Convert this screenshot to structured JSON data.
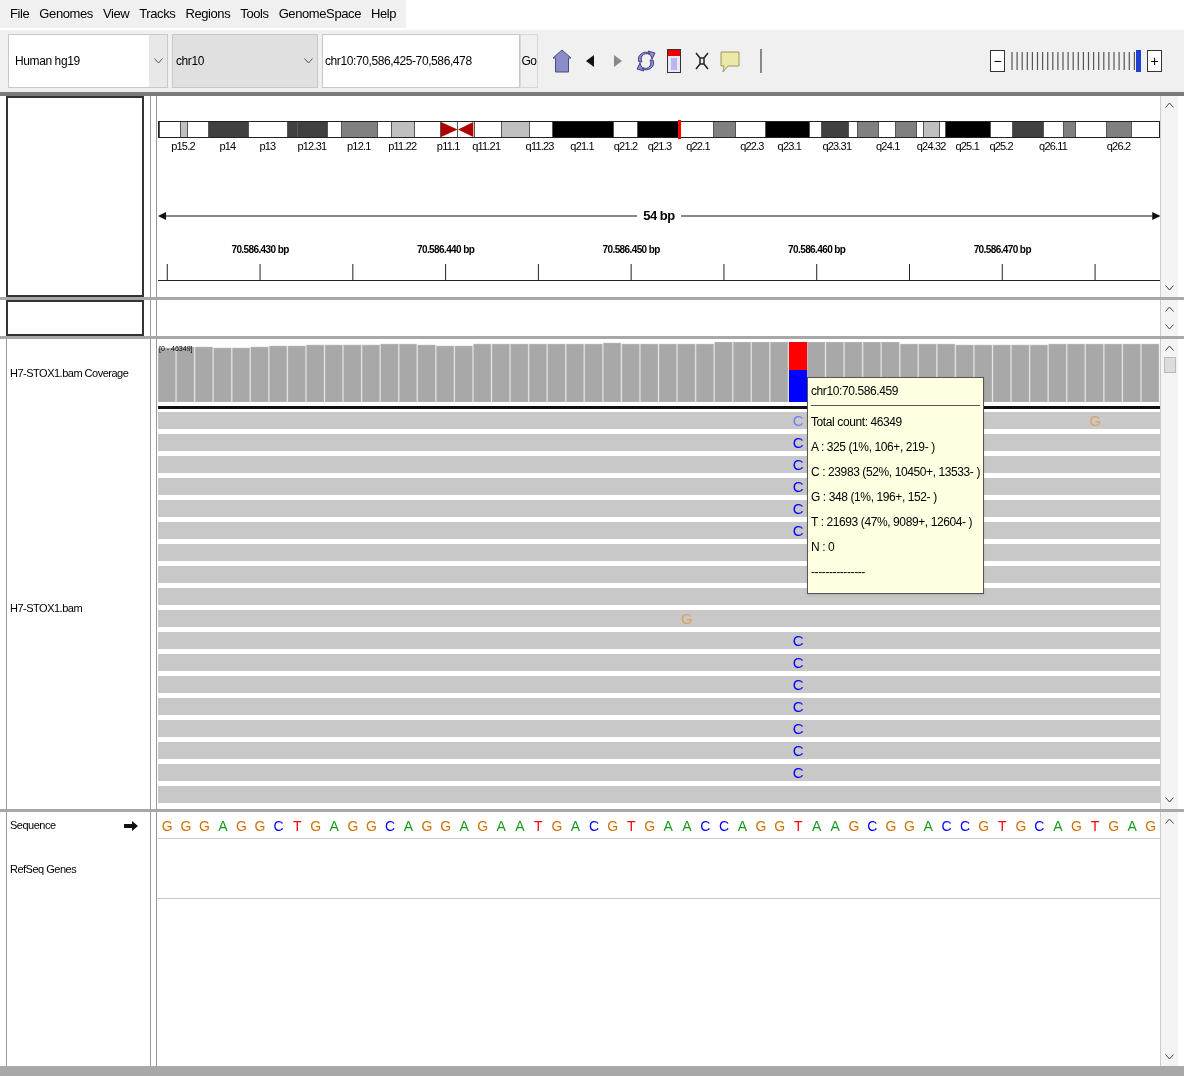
{
  "menu": [
    "File",
    "Genomes",
    "View",
    "Tracks",
    "Regions",
    "Tools",
    "GenomeSpace",
    "Help"
  ],
  "toolbar": {
    "genome": "Human hg19",
    "chromosome": "chr10",
    "locus": "chr10:70,586,425-70,586,478",
    "go": "Go",
    "zoom": {
      "minus": "−",
      "plus": "+",
      "level": 1
    }
  },
  "ideogram": {
    "bands": [
      {
        "kind": "gneg"
      },
      {
        "kind": "gpos25",
        "label": "p15.2"
      },
      {
        "kind": "gneg"
      },
      {
        "kind": "gpos75",
        "label": "p14"
      },
      {
        "kind": "gneg",
        "label": "p13"
      },
      {
        "kind": "gpos75"
      },
      {
        "kind": "gpos75",
        "label": "p12.31"
      },
      {
        "kind": "gneg"
      },
      {
        "kind": "gpos50",
        "label": "p12.1"
      },
      {
        "kind": "gneg"
      },
      {
        "kind": "gpos25",
        "label": "p11.22"
      },
      {
        "kind": "gneg"
      },
      {
        "kind": "acen_p",
        "label": "p11.1"
      },
      {
        "kind": "acen_q"
      },
      {
        "kind": "gneg",
        "label": "q11.21"
      },
      {
        "kind": "gpos25"
      },
      {
        "kind": "gneg",
        "label": "q11.23"
      },
      {
        "kind": "gpos100",
        "label": "q21.1"
      },
      {
        "kind": "gneg",
        "label": "q21.2"
      },
      {
        "kind": "gpos100",
        "label": "q21.3"
      },
      {
        "kind": "gneg",
        "label": "q22.1",
        "marker": true
      },
      {
        "kind": "gpos50"
      },
      {
        "kind": "gneg",
        "label": "q22.3"
      },
      {
        "kind": "gpos100",
        "label": "q23.1"
      },
      {
        "kind": "gneg"
      },
      {
        "kind": "gpos75",
        "label": "q23.31"
      },
      {
        "kind": "gneg"
      },
      {
        "kind": "gpos50"
      },
      {
        "kind": "gneg",
        "label": "q24.1"
      },
      {
        "kind": "gpos50"
      },
      {
        "kind": "gneg"
      },
      {
        "kind": "gpos25",
        "label": "q24.32"
      },
      {
        "kind": "gneg"
      },
      {
        "kind": "gpos100",
        "label": "q25.1"
      },
      {
        "kind": "gneg",
        "label": "q25.2"
      },
      {
        "kind": "gpos75"
      },
      {
        "kind": "gneg",
        "label": "q26.11"
      },
      {
        "kind": "gpos50"
      },
      {
        "kind": "gneg"
      },
      {
        "kind": "gpos50",
        "label": "q26.2"
      },
      {
        "kind": "gneg"
      }
    ]
  },
  "ruler": {
    "span": "54 bp",
    "ticks": [
      "70.586.430 bp",
      "70.586.440 bp",
      "70.586.450 bp",
      "70.586.460 bp",
      "70.586.470 bp"
    ]
  },
  "coverage": {
    "name": "H7-STOX1.bam Coverage",
    "range": "[0 - 46349]"
  },
  "alignment": {
    "name": "H7-STOX1.bam",
    "rows": [
      {
        "cells": [
          null,
          null,
          null,
          null,
          null,
          null,
          null,
          null,
          null,
          null,
          null,
          null,
          null,
          null,
          null,
          null,
          null,
          null,
          null,
          null,
          null,
          null,
          null,
          null,
          null,
          null,
          null,
          null,
          null,
          null,
          null,
          null,
          null,
          null,
          {
            "base": "C",
            "faded": true
          },
          null,
          null,
          null,
          null,
          null,
          null,
          null,
          null,
          null,
          null,
          null,
          null,
          null,
          null,
          null,
          {
            "base": "G",
            "faded": true
          },
          null,
          null,
          null
        ]
      },
      {
        "cells": [
          null,
          null,
          null,
          null,
          null,
          null,
          null,
          null,
          null,
          null,
          null,
          null,
          null,
          null,
          null,
          null,
          null,
          null,
          null,
          null,
          null,
          null,
          null,
          null,
          null,
          null,
          null,
          null,
          null,
          null,
          null,
          null,
          null,
          null,
          {
            "base": "C",
            "faded": false
          },
          null,
          null,
          null,
          null,
          null,
          null,
          null,
          null,
          null,
          null,
          null,
          null,
          null,
          null,
          null,
          null,
          null,
          null,
          null
        ]
      },
      {
        "cells": [
          null,
          null,
          null,
          null,
          null,
          null,
          null,
          null,
          null,
          null,
          null,
          null,
          null,
          null,
          null,
          null,
          null,
          null,
          null,
          null,
          null,
          null,
          null,
          null,
          null,
          null,
          null,
          null,
          null,
          null,
          null,
          null,
          null,
          null,
          {
            "base": "C",
            "faded": false
          },
          null,
          null,
          null,
          null,
          null,
          null,
          null,
          null,
          null,
          null,
          null,
          null,
          null,
          null,
          null,
          null,
          null,
          null,
          null
        ]
      },
      {
        "cells": [
          null,
          null,
          null,
          null,
          null,
          null,
          null,
          null,
          null,
          null,
          null,
          null,
          null,
          null,
          null,
          null,
          null,
          null,
          null,
          null,
          null,
          null,
          null,
          null,
          null,
          null,
          null,
          null,
          null,
          null,
          null,
          null,
          null,
          null,
          {
            "base": "C",
            "faded": false
          },
          null,
          null,
          null,
          null,
          null,
          null,
          null,
          null,
          null,
          null,
          null,
          null,
          null,
          null,
          null,
          null,
          null,
          null,
          null
        ]
      },
      {
        "cells": [
          null,
          null,
          null,
          null,
          null,
          null,
          null,
          null,
          null,
          null,
          null,
          null,
          null,
          null,
          null,
          null,
          null,
          null,
          null,
          null,
          null,
          null,
          null,
          null,
          null,
          null,
          null,
          null,
          null,
          null,
          null,
          null,
          null,
          null,
          {
            "base": "C",
            "faded": false
          },
          null,
          null,
          null,
          null,
          null,
          null,
          null,
          null,
          null,
          null,
          null,
          null,
          null,
          null,
          null,
          null,
          null,
          null,
          null
        ]
      },
      {
        "cells": [
          null,
          null,
          null,
          null,
          null,
          null,
          null,
          null,
          null,
          null,
          null,
          null,
          null,
          null,
          null,
          null,
          null,
          null,
          null,
          null,
          null,
          null,
          null,
          null,
          null,
          null,
          null,
          null,
          null,
          null,
          null,
          null,
          null,
          null,
          {
            "base": "C",
            "faded": false
          },
          null,
          null,
          null,
          null,
          null,
          null,
          null,
          null,
          null,
          null,
          null,
          null,
          null,
          null,
          null,
          null,
          null,
          null,
          null
        ]
      },
      {
        "cells": [
          null,
          null,
          null,
          null,
          null,
          null,
          null,
          null,
          null,
          null,
          null,
          null,
          null,
          null,
          null,
          null,
          null,
          null,
          null,
          null,
          null,
          null,
          null,
          null,
          null,
          null,
          null,
          null,
          null,
          null,
          null,
          null,
          null,
          null,
          null,
          null,
          null,
          null,
          null,
          null,
          null,
          null,
          null,
          null,
          null,
          null,
          null,
          null,
          null,
          null,
          null,
          null,
          null,
          null
        ]
      },
      {
        "cells": [
          null,
          null,
          null,
          null,
          null,
          null,
          null,
          null,
          null,
          null,
          null,
          null,
          null,
          null,
          null,
          null,
          null,
          null,
          null,
          null,
          null,
          null,
          null,
          null,
          null,
          null,
          null,
          null,
          null,
          null,
          null,
          null,
          null,
          null,
          null,
          null,
          null,
          null,
          null,
          null,
          null,
          null,
          null,
          null,
          null,
          null,
          null,
          null,
          null,
          null,
          null,
          null,
          null,
          null
        ]
      },
      {
        "cells": [
          null,
          null,
          null,
          null,
          null,
          null,
          null,
          null,
          null,
          null,
          null,
          null,
          null,
          null,
          null,
          null,
          null,
          null,
          null,
          null,
          null,
          null,
          null,
          null,
          null,
          null,
          null,
          null,
          null,
          null,
          null,
          null,
          null,
          null,
          null,
          null,
          null,
          null,
          null,
          null,
          null,
          null,
          null,
          null,
          null,
          null,
          null,
          null,
          null,
          null,
          null,
          null,
          null,
          null
        ]
      },
      {
        "cells": [
          null,
          null,
          null,
          null,
          null,
          null,
          null,
          null,
          null,
          null,
          null,
          null,
          null,
          null,
          null,
          null,
          null,
          null,
          null,
          null,
          null,
          null,
          null,
          null,
          null,
          null,
          null,
          null,
          {
            "base": "G",
            "faded": true
          },
          null,
          null,
          null,
          null,
          null,
          null,
          null,
          null,
          null,
          null,
          null,
          null,
          null,
          null,
          null,
          null,
          null,
          null,
          null,
          null,
          null,
          null,
          null,
          null,
          null
        ]
      },
      {
        "cells": [
          null,
          null,
          null,
          null,
          null,
          null,
          null,
          null,
          null,
          null,
          null,
          null,
          null,
          null,
          null,
          null,
          null,
          null,
          null,
          null,
          null,
          null,
          null,
          null,
          null,
          null,
          null,
          null,
          null,
          null,
          null,
          null,
          null,
          null,
          {
            "base": "C",
            "faded": false
          },
          null,
          null,
          null,
          null,
          null,
          null,
          null,
          null,
          null,
          null,
          null,
          null,
          null,
          null,
          null,
          null,
          null,
          null,
          null
        ]
      },
      {
        "cells": [
          null,
          null,
          null,
          null,
          null,
          null,
          null,
          null,
          null,
          null,
          null,
          null,
          null,
          null,
          null,
          null,
          null,
          null,
          null,
          null,
          null,
          null,
          null,
          null,
          null,
          null,
          null,
          null,
          null,
          null,
          null,
          null,
          null,
          null,
          {
            "base": "C",
            "faded": false
          },
          null,
          null,
          null,
          null,
          null,
          null,
          null,
          null,
          null,
          null,
          null,
          null,
          null,
          null,
          null,
          null,
          null,
          null,
          null
        ]
      },
      {
        "cells": [
          null,
          null,
          null,
          null,
          null,
          null,
          null,
          null,
          null,
          null,
          null,
          null,
          null,
          null,
          null,
          null,
          null,
          null,
          null,
          null,
          null,
          null,
          null,
          null,
          null,
          null,
          null,
          null,
          null,
          null,
          null,
          null,
          null,
          null,
          {
            "base": "C",
            "faded": false
          },
          null,
          null,
          null,
          null,
          null,
          null,
          null,
          null,
          null,
          null,
          null,
          null,
          null,
          null,
          null,
          null,
          null,
          null,
          null
        ]
      },
      {
        "cells": [
          null,
          null,
          null,
          null,
          null,
          null,
          null,
          null,
          null,
          null,
          null,
          null,
          null,
          null,
          null,
          null,
          null,
          null,
          null,
          null,
          null,
          null,
          null,
          null,
          null,
          null,
          null,
          null,
          null,
          null,
          null,
          null,
          null,
          null,
          {
            "base": "C",
            "faded": false
          },
          null,
          null,
          null,
          null,
          null,
          null,
          null,
          null,
          null,
          null,
          null,
          null,
          null,
          null,
          null,
          null,
          null,
          null,
          null
        ]
      },
      {
        "cells": [
          null,
          null,
          null,
          null,
          null,
          null,
          null,
          null,
          null,
          null,
          null,
          null,
          null,
          null,
          null,
          null,
          null,
          null,
          null,
          null,
          null,
          null,
          null,
          null,
          null,
          null,
          null,
          null,
          null,
          null,
          null,
          null,
          null,
          null,
          {
            "base": "C",
            "faded": false
          },
          null,
          null,
          null,
          null,
          null,
          null,
          null,
          null,
          null,
          null,
          null,
          null,
          null,
          null,
          null,
          null,
          null,
          null,
          null
        ]
      },
      {
        "cells": [
          null,
          null,
          null,
          null,
          null,
          null,
          null,
          null,
          null,
          null,
          null,
          null,
          null,
          null,
          null,
          null,
          null,
          null,
          null,
          null,
          null,
          null,
          null,
          null,
          null,
          null,
          null,
          null,
          null,
          null,
          null,
          null,
          null,
          null,
          {
            "base": "C",
            "faded": false
          },
          null,
          null,
          null,
          null,
          null,
          null,
          null,
          null,
          null,
          null,
          null,
          null,
          null,
          null,
          null,
          null,
          null,
          null,
          null
        ]
      },
      {
        "cells": [
          null,
          null,
          null,
          null,
          null,
          null,
          null,
          null,
          null,
          null,
          null,
          null,
          null,
          null,
          null,
          null,
          null,
          null,
          null,
          null,
          null,
          null,
          null,
          null,
          null,
          null,
          null,
          null,
          null,
          null,
          null,
          null,
          null,
          null,
          {
            "base": "C",
            "faded": false
          },
          null,
          null,
          null,
          null,
          null,
          null,
          null,
          null,
          null,
          null,
          null,
          null,
          null,
          null,
          null,
          null,
          null,
          null,
          null
        ]
      },
      {
        "cells": [
          null,
          null,
          null,
          null,
          null,
          null,
          null,
          null,
          null,
          null,
          null,
          null,
          null,
          null,
          null,
          null,
          null,
          null,
          null,
          null,
          null,
          null,
          null,
          null,
          null,
          null,
          null,
          null,
          null,
          null,
          null,
          null,
          null,
          null,
          null,
          null,
          null,
          null,
          null,
          null,
          null,
          null,
          null,
          null,
          null,
          null,
          null,
          null,
          null,
          null,
          null,
          null,
          null,
          null
        ]
      }
    ]
  },
  "tooltip": {
    "title": "chr10:70.586.459",
    "lines": [
      "Total count: 46349",
      "A : 325 (1%, 106+, 219- )",
      "C : 23983 (52%, 10450+, 13533- )",
      "G : 348 (1%, 196+, 152- )",
      "T : 21693 (47%, 9089+, 12604- )",
      "N : 0",
      "---------------"
    ]
  },
  "sequence": {
    "name": "Sequence",
    "bases": [
      "G",
      "G",
      "G",
      "A",
      "G",
      "G",
      "C",
      "T",
      "G",
      "A",
      "G",
      "G",
      "C",
      "A",
      "G",
      "G",
      "A",
      "G",
      "A",
      "A",
      "T",
      "G",
      "A",
      "C",
      "G",
      "T",
      "G",
      "A",
      "A",
      "C",
      "C",
      "A",
      "G",
      "G",
      "T",
      "A",
      "A",
      "G",
      "C",
      "G",
      "G",
      "A",
      "C",
      "C",
      "G",
      "T",
      "G",
      "C",
      "A",
      "G",
      "T",
      "G",
      "A",
      "G"
    ]
  },
  "genes": {
    "name": "RefSeq Genes"
  }
}
